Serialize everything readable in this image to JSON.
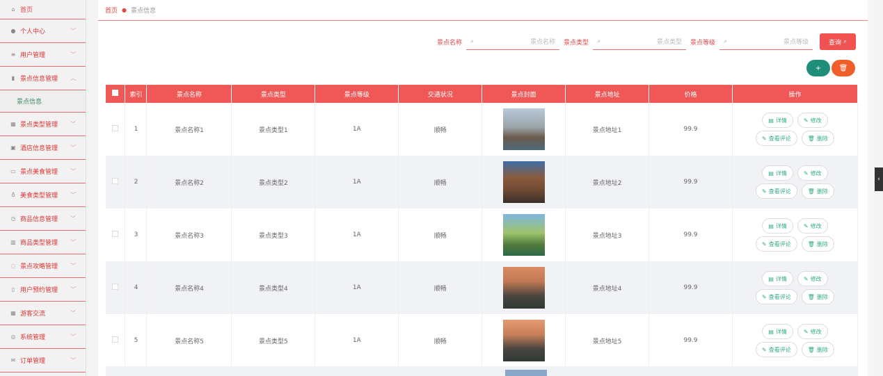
{
  "sidebar": {
    "home": {
      "label": "首页",
      "icon": "home-icon"
    },
    "items": [
      {
        "label": "个人中心",
        "icon": "user-icon"
      },
      {
        "label": "用户管理",
        "icon": "sliders-icon"
      },
      {
        "label": "景点信息管理",
        "icon": "chart-icon",
        "expanded": true
      },
      {
        "label": "景点类型管理",
        "icon": "grid-icon"
      },
      {
        "label": "酒店信息管理",
        "icon": "image-icon"
      },
      {
        "label": "景点美食管理",
        "icon": "card-icon"
      },
      {
        "label": "美食类型管理",
        "icon": "mic-icon"
      },
      {
        "label": "商品信息管理",
        "icon": "clock-icon"
      },
      {
        "label": "商品类型管理",
        "icon": "bar-chart-icon"
      },
      {
        "label": "景点攻略管理",
        "icon": "bell-off-icon"
      },
      {
        "label": "用户预约管理",
        "icon": "phone-icon"
      },
      {
        "label": "游客交流",
        "icon": "grid-icon"
      },
      {
        "label": "系统管理",
        "icon": "compass-icon"
      },
      {
        "label": "订单管理",
        "icon": "mail-icon"
      }
    ],
    "sub_item": "景点信息"
  },
  "breadcrumb": {
    "home": "首页",
    "current": "景点信息"
  },
  "filters": [
    {
      "label": "景点名称",
      "placeholder": "景点名称"
    },
    {
      "label": "景点类型",
      "placeholder": "景点类型"
    },
    {
      "label": "景点等级",
      "placeholder": "景点等级"
    }
  ],
  "query_button": "查询",
  "table": {
    "headers": [
      "索引",
      "景点名称",
      "景点类型",
      "景点等级",
      "交通状况",
      "景点封面",
      "景点地址",
      "价格",
      "操作"
    ],
    "rows": [
      {
        "index": "1",
        "name": "景点名称1",
        "type": "景点类型1",
        "level": "1A",
        "traffic": "顺畅",
        "address": "景点地址1",
        "price": "99.9"
      },
      {
        "index": "2",
        "name": "景点名称2",
        "type": "景点类型2",
        "level": "1A",
        "traffic": "顺畅",
        "address": "景点地址2",
        "price": "99.9"
      },
      {
        "index": "3",
        "name": "景点名称3",
        "type": "景点类型3",
        "level": "1A",
        "traffic": "顺畅",
        "address": "景点地址3",
        "price": "99.9"
      },
      {
        "index": "4",
        "name": "景点名称4",
        "type": "景点类型4",
        "level": "1A",
        "traffic": "顺畅",
        "address": "景点地址4",
        "price": "99.9"
      },
      {
        "index": "5",
        "name": "景点名称5",
        "type": "景点类型5",
        "level": "1A",
        "traffic": "顺畅",
        "address": "景点地址5",
        "price": "99.9"
      }
    ],
    "ops": {
      "detail": "详情",
      "edit": "修改",
      "comments": "查看评论",
      "delete": "删除"
    }
  },
  "colors": {
    "accent": "#f05858",
    "add": "#1e8e79",
    "delete": "#f05f2a",
    "sub_item": "#3b8a5f"
  }
}
